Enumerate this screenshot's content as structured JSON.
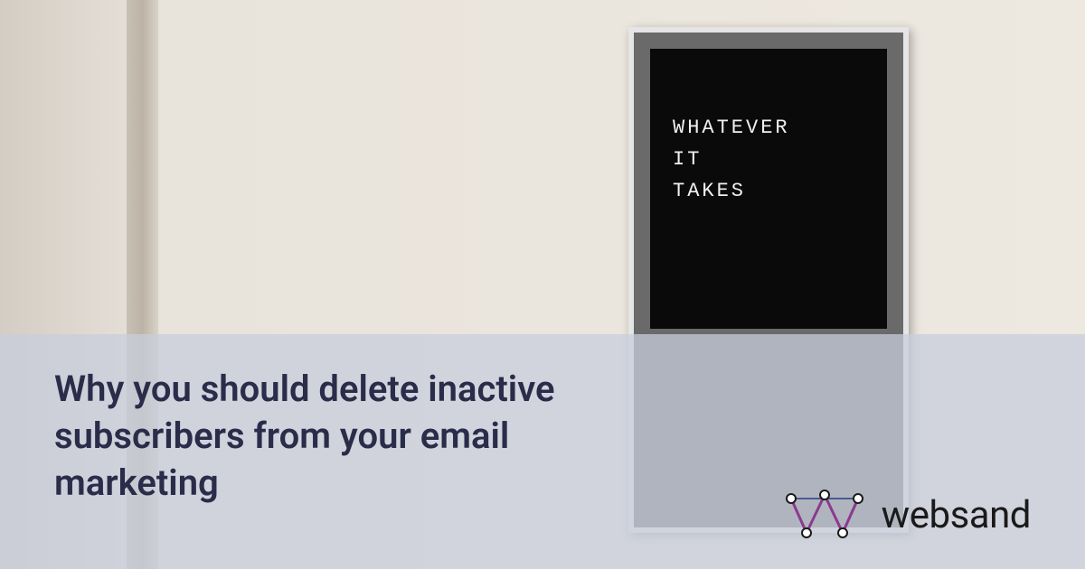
{
  "sign": {
    "line1": "WHATEVER",
    "line2": "IT",
    "line3": "TAKES"
  },
  "overlay": {
    "headline": "Why you should delete inactive subscribers from your email marketing"
  },
  "brand": {
    "name": "websand"
  }
}
